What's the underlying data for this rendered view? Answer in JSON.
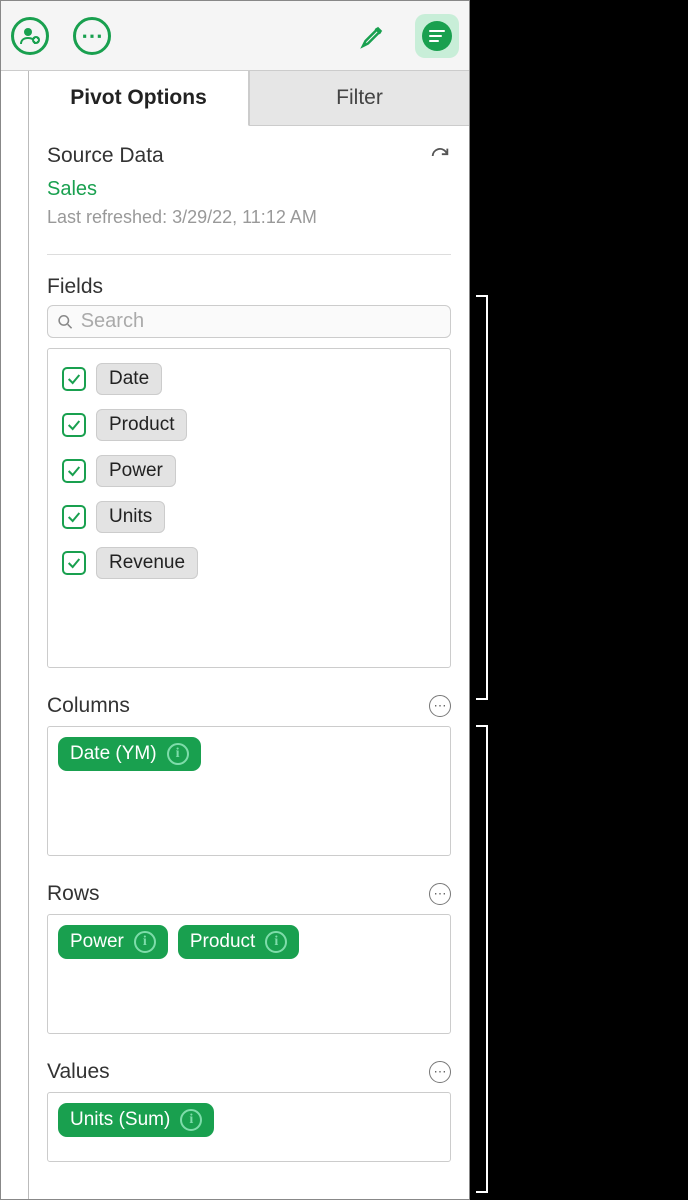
{
  "tabs": {
    "pivot": "Pivot Options",
    "filter": "Filter"
  },
  "source": {
    "label": "Source Data",
    "name": "Sales",
    "refreshed": "Last refreshed: 3/29/22, 11:12 AM"
  },
  "fields": {
    "label": "Fields",
    "search_placeholder": "Search",
    "items": [
      {
        "label": "Date",
        "checked": true
      },
      {
        "label": "Product",
        "checked": true
      },
      {
        "label": "Power",
        "checked": true
      },
      {
        "label": "Units",
        "checked": true
      },
      {
        "label": "Revenue",
        "checked": true
      }
    ]
  },
  "columns": {
    "label": "Columns",
    "pills": [
      "Date (YM)"
    ]
  },
  "rows": {
    "label": "Rows",
    "pills": [
      "Power",
      "Product"
    ]
  },
  "values": {
    "label": "Values",
    "pills": [
      "Units (Sum)"
    ]
  }
}
